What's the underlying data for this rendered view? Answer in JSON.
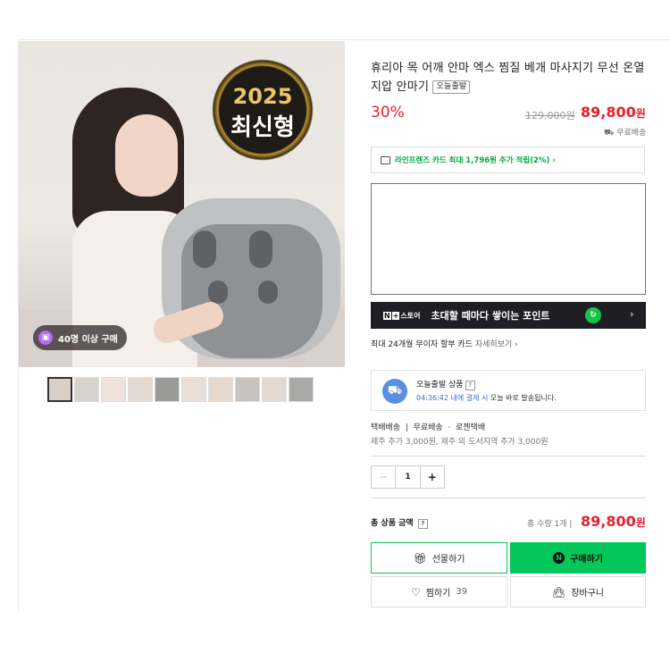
{
  "product": {
    "title": "휴리아 목 어깨 안마 엑스 찜질 베개 마사지기 무선 온열 지압 안마기",
    "today_tag": "오늘출발",
    "image": {
      "seal_year": "2025",
      "seal_text": "최신형",
      "buyer_badge": "40명 이상 구매"
    },
    "thumbnail_count": 10,
    "discount": "30%",
    "original_price": "129,000원",
    "price": "89,800",
    "price_unit": "원",
    "shipping_badge": "무료배송"
  },
  "card_promo": "라인프렌즈 카드 최대 1,796원 추가 적립(2%) ›",
  "npay_banner": {
    "logo_n": "N",
    "logo_pay": "+",
    "logo_store": "스토어",
    "text": "초대할 때마다 쌓이는 포인트",
    "arrow": "›"
  },
  "installment": {
    "text": "최대 24개월 무이자 할부 카드",
    "more": "자세히보기 ›"
  },
  "today_ship": {
    "title": "오늘출발 상품",
    "help": "?",
    "time": "04:36:42 내에 결제 시",
    "desc": " 오늘 바로 발송됩니다."
  },
  "delivery": {
    "line": "택배배송  |  무료배송  ·  로젠택배",
    "extra": "제주 추가 3,000원, 제주 외 도서지역 추가 3,000원"
  },
  "quantity": {
    "minus": "−",
    "value": "1",
    "plus": "+"
  },
  "total": {
    "label": "총 상품 금액",
    "help": "?",
    "qty_text": "총 수량 1개  |",
    "price": "89,800",
    "unit": "원"
  },
  "buttons": {
    "gift": "선물하기",
    "buy": "구매하기",
    "like": "찜하기",
    "like_count": "39",
    "cart": "장바구니"
  },
  "colors": {
    "accent_red": "#e5202e",
    "naver_green": "#03c75a"
  }
}
